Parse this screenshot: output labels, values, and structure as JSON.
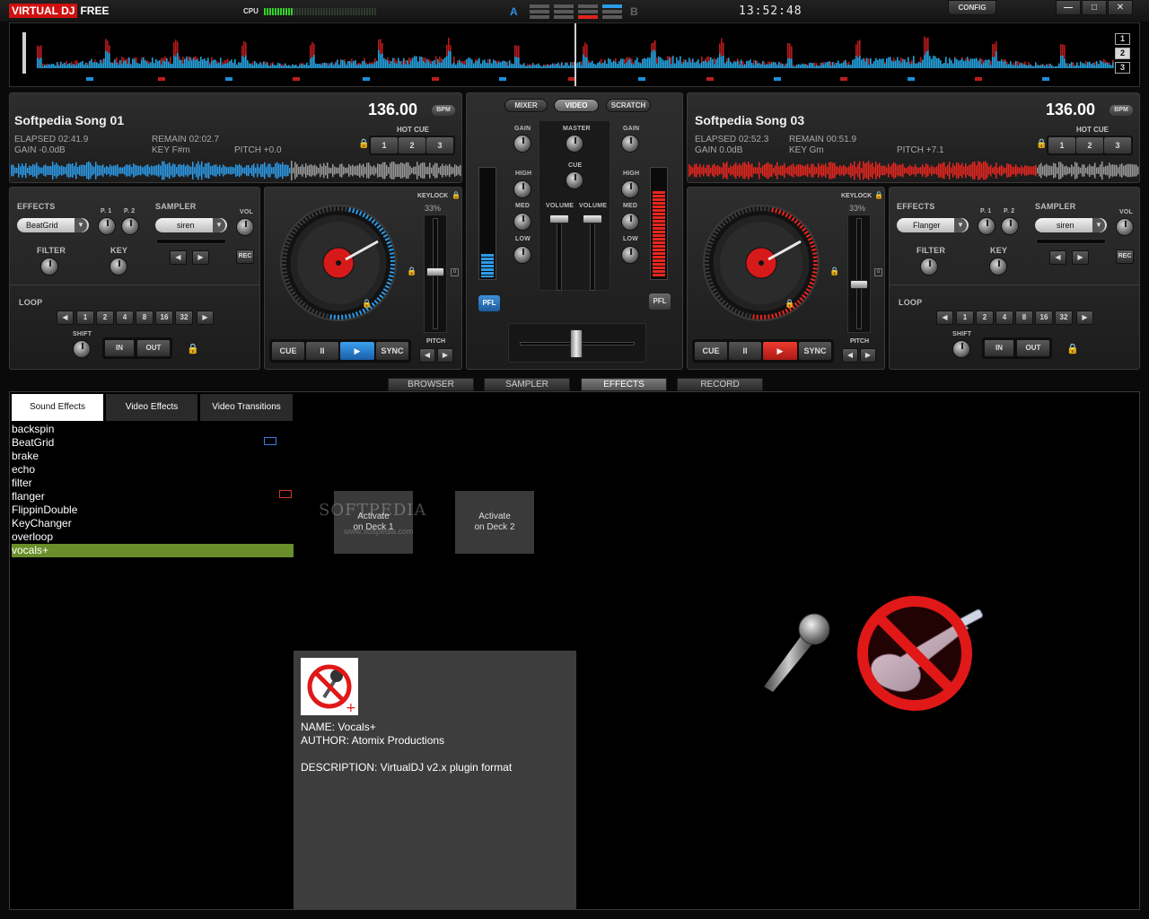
{
  "app": {
    "logo_a": "VIRTUAL DJ",
    "logo_b": "FREE",
    "cpu_label": "CPU",
    "ab_left": "A",
    "ab_right": "B",
    "clock": "13:52:48",
    "config_label": "CONFIG",
    "minimize": "—",
    "maximize": "□",
    "close": "✕"
  },
  "overview": {
    "slots": [
      "1",
      "2",
      "3"
    ],
    "selected": 2
  },
  "deck1": {
    "title": "Softpedia Song 01",
    "bpm": "136.00",
    "bpm_label": "BPM",
    "elapsed": "ELAPSED 02:41.9",
    "remain": "REMAIN 02:02.7",
    "gain": "GAIN -0.0dB",
    "key": "KEY F#m",
    "pitch": "PITCH +0.0",
    "hotcue_label": "HOT CUE",
    "hotcues": [
      "1",
      "2",
      "3"
    ],
    "effects_label": "EFFECTS",
    "effect_value": "BeatGrid",
    "p1": "P. 1",
    "p2": "P. 2",
    "filter_label": "FILTER",
    "key_label": "KEY",
    "sampler_label": "SAMPLER",
    "sampler_value": "siren",
    "vol_label": "VOL",
    "rec_label": "REC",
    "loop_label": "LOOP",
    "loop_values": [
      "1",
      "2",
      "4",
      "8",
      "16",
      "32"
    ],
    "shift_label": "SHIFT",
    "in_label": "IN",
    "out_label": "OUT",
    "keylock_label": "KEYLOCK",
    "keylock_pct": "33%",
    "pitch_label": "PITCH",
    "cue": "CUE",
    "pause": "II",
    "play": "▶",
    "sync": "SYNC",
    "accent": "#2d9be8"
  },
  "deck2": {
    "title": "Softpedia Song 03",
    "bpm": "136.00",
    "bpm_label": "BPM",
    "elapsed": "ELAPSED 02:52.3",
    "remain": "REMAIN 00:51.9",
    "gain": "GAIN 0.0dB",
    "key": "KEY Gm",
    "pitch": "PITCH +7.1",
    "hotcue_label": "HOT CUE",
    "hotcues": [
      "1",
      "2",
      "3"
    ],
    "effects_label": "EFFECTS",
    "effect_value": "Flanger",
    "p1": "P. 1",
    "p2": "P. 2",
    "filter_label": "FILTER",
    "key_label": "KEY",
    "sampler_label": "SAMPLER",
    "sampler_value": "siren",
    "vol_label": "VOL",
    "rec_label": "REC",
    "loop_label": "LOOP",
    "loop_values": [
      "1",
      "2",
      "4",
      "8",
      "16",
      "32"
    ],
    "shift_label": "SHIFT",
    "in_label": "IN",
    "out_label": "OUT",
    "keylock_label": "KEYLOCK",
    "keylock_pct": "33%",
    "pitch_label": "PITCH",
    "cue": "CUE",
    "pause": "II",
    "play": "▶",
    "sync": "SYNC",
    "accent": "#e8261e"
  },
  "mixer": {
    "tabs": [
      "MIXER",
      "VIDEO",
      "SCRATCH"
    ],
    "active_tab": "VIDEO",
    "gain": "GAIN",
    "master": "MASTER",
    "cue": "CUE",
    "high": "HIGH",
    "med": "MED",
    "low": "LOW",
    "volume": "VOLUME",
    "pfl": "PFL"
  },
  "bottom_tabs": [
    "BROWSER",
    "SAMPLER",
    "EFFECTS",
    "RECORD"
  ],
  "bottom_active": "EFFECTS",
  "effects_panel": {
    "subtabs": [
      "Sound Effects",
      "Video Effects",
      "Video Transitions"
    ],
    "active_subtab": "Sound Effects",
    "list": [
      "backspin",
      "BeatGrid",
      "brake",
      "echo",
      "filter",
      "flanger",
      "FlippinDouble",
      "KeyChanger",
      "overloop",
      "vocals+"
    ],
    "selected": "vocals+",
    "activate_deck1": [
      "Activate",
      "on Deck 1"
    ],
    "activate_deck2": [
      "Activate",
      "on Deck 2"
    ],
    "watermark": "SOFTPEDIA",
    "watermark_sub": "www.softpedia.com",
    "info": {
      "name": "NAME: Vocals+",
      "author": "AUTHOR: Atomix Productions",
      "description": "DESCRIPTION: VirtualDJ v2.x plugin format"
    }
  }
}
